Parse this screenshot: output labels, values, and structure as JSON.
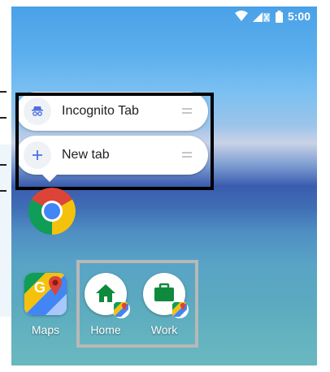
{
  "status_bar": {
    "time": "5:00",
    "icons": [
      "wifi-icon",
      "cell-signal-icon",
      "battery-icon"
    ]
  },
  "shortcuts": [
    {
      "label": "Incognito Tab",
      "icon": "incognito-icon"
    },
    {
      "label": "New tab",
      "icon": "plus-icon"
    }
  ],
  "apps": {
    "chrome": {
      "icon": "chrome-icon"
    },
    "maps": {
      "label": "Maps",
      "icon": "google-maps-icon"
    },
    "home": {
      "label": "Home",
      "icon": "home-icon"
    },
    "work": {
      "label": "Work",
      "icon": "briefcase-icon"
    }
  },
  "colors": {
    "highlight_primary": "#000000",
    "highlight_secondary": "#b8b8b8",
    "home_work_icon_green": "#0f8a3c",
    "chrome_red": "#db4437",
    "chrome_yellow": "#f4c20d",
    "chrome_green": "#0f9d58",
    "chrome_blue": "#4285f4"
  }
}
